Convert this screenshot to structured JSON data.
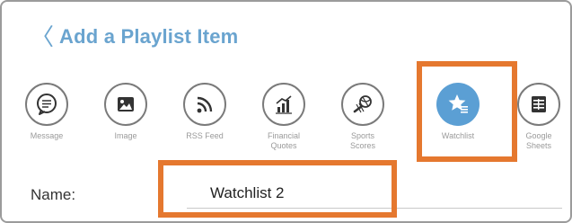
{
  "header": {
    "back_glyph": "〈",
    "title": "Add a Playlist Item"
  },
  "items": [
    {
      "label": "Message",
      "icon": "message-icon"
    },
    {
      "label": "Image",
      "icon": "image-icon"
    },
    {
      "label": "RSS Feed",
      "icon": "rss-feed-icon"
    },
    {
      "label": "Financial\nQuotes",
      "icon": "financial-quotes-icon"
    },
    {
      "label": "Sports\nScores",
      "icon": "sports-scores-icon"
    },
    {
      "label": "Watchlist",
      "icon": "watchlist-star-icon",
      "selected": true
    },
    {
      "label": "Google\nSheets",
      "icon": "google-sheets-icon"
    }
  ],
  "form": {
    "name_label": "Name:",
    "name_value": "Watchlist 2"
  },
  "colors": {
    "accent": "#6aa4cf",
    "selected_fill": "#5b9fd4",
    "highlight": "#e5782f"
  }
}
